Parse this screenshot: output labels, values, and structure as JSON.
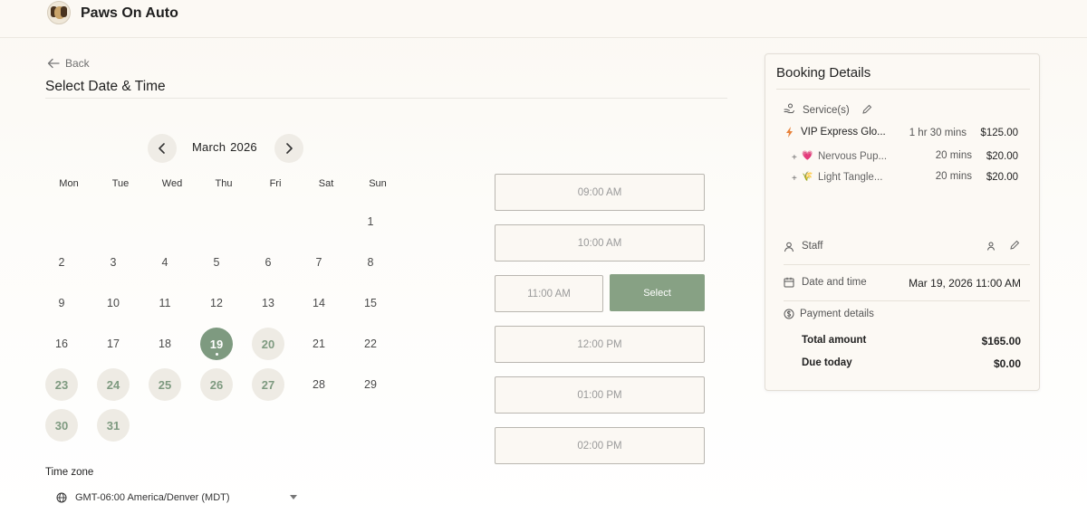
{
  "header": {
    "brand": "Paws On Auto"
  },
  "nav": {
    "back_label": "Back",
    "page_title": "Select Date & Time"
  },
  "calendar": {
    "month": "March",
    "year": "2026",
    "weekdays": [
      "Mon",
      "Tue",
      "Wed",
      "Thu",
      "Fri",
      "Sat",
      "Sun"
    ],
    "days": [
      "1",
      "2",
      "3",
      "4",
      "5",
      "6",
      "7",
      "8",
      "9",
      "10",
      "11",
      "12",
      "13",
      "14",
      "15",
      "16",
      "17",
      "18",
      "19",
      "20",
      "21",
      "22",
      "23",
      "24",
      "25",
      "26",
      "27",
      "28",
      "29",
      "30",
      "31"
    ],
    "selected_day": "19",
    "available_days": [
      "20",
      "23",
      "24",
      "25",
      "26",
      "27",
      "30",
      "31"
    ]
  },
  "timezone": {
    "label": "Time zone",
    "value": "GMT-06:00 America/Denver (MDT)"
  },
  "slots": [
    "09:00 AM",
    "10:00 AM",
    "11:00 AM",
    "12:00 PM",
    "01:00 PM",
    "02:00 PM"
  ],
  "selected_slot": "11:00 AM",
  "select_button_label": "Select",
  "booking": {
    "title": "Booking Details",
    "services_label": "Service(s)",
    "services": [
      {
        "name": "VIP Express Glo...",
        "duration": "1 hr 30 mins",
        "price": "$125.00"
      }
    ],
    "addons": [
      {
        "prefix": "+",
        "emoji": "💗",
        "name": "Nervous Pup...",
        "duration": "20 mins",
        "price": "$20.00"
      },
      {
        "prefix": "+",
        "emoji": "🌾",
        "name": "Light Tangle...",
        "duration": "20 mins",
        "price": "$20.00"
      }
    ],
    "staff_label": "Staff",
    "date_time_label": "Date and time",
    "date_time_value": "Mar 19, 2026 11:00 AM",
    "payment_label": "Payment details",
    "total_label": "Total amount",
    "total_value": "$165.00",
    "due_label": "Due today",
    "due_value": "$0.00"
  },
  "colors": {
    "accent": "#7e9a80",
    "select_button": "#87a184",
    "panel_bg": "#fcf9f4"
  },
  "icons": {
    "back": "arrow-left-icon",
    "prev": "chevron-left-icon",
    "next": "chevron-right-icon",
    "globe": "globe-icon",
    "service": "service-icon",
    "edit": "pencil-icon",
    "staff": "user-icon",
    "calendar": "calendar-icon",
    "payment": "dollar-icon",
    "bolt": "lightning-icon"
  }
}
